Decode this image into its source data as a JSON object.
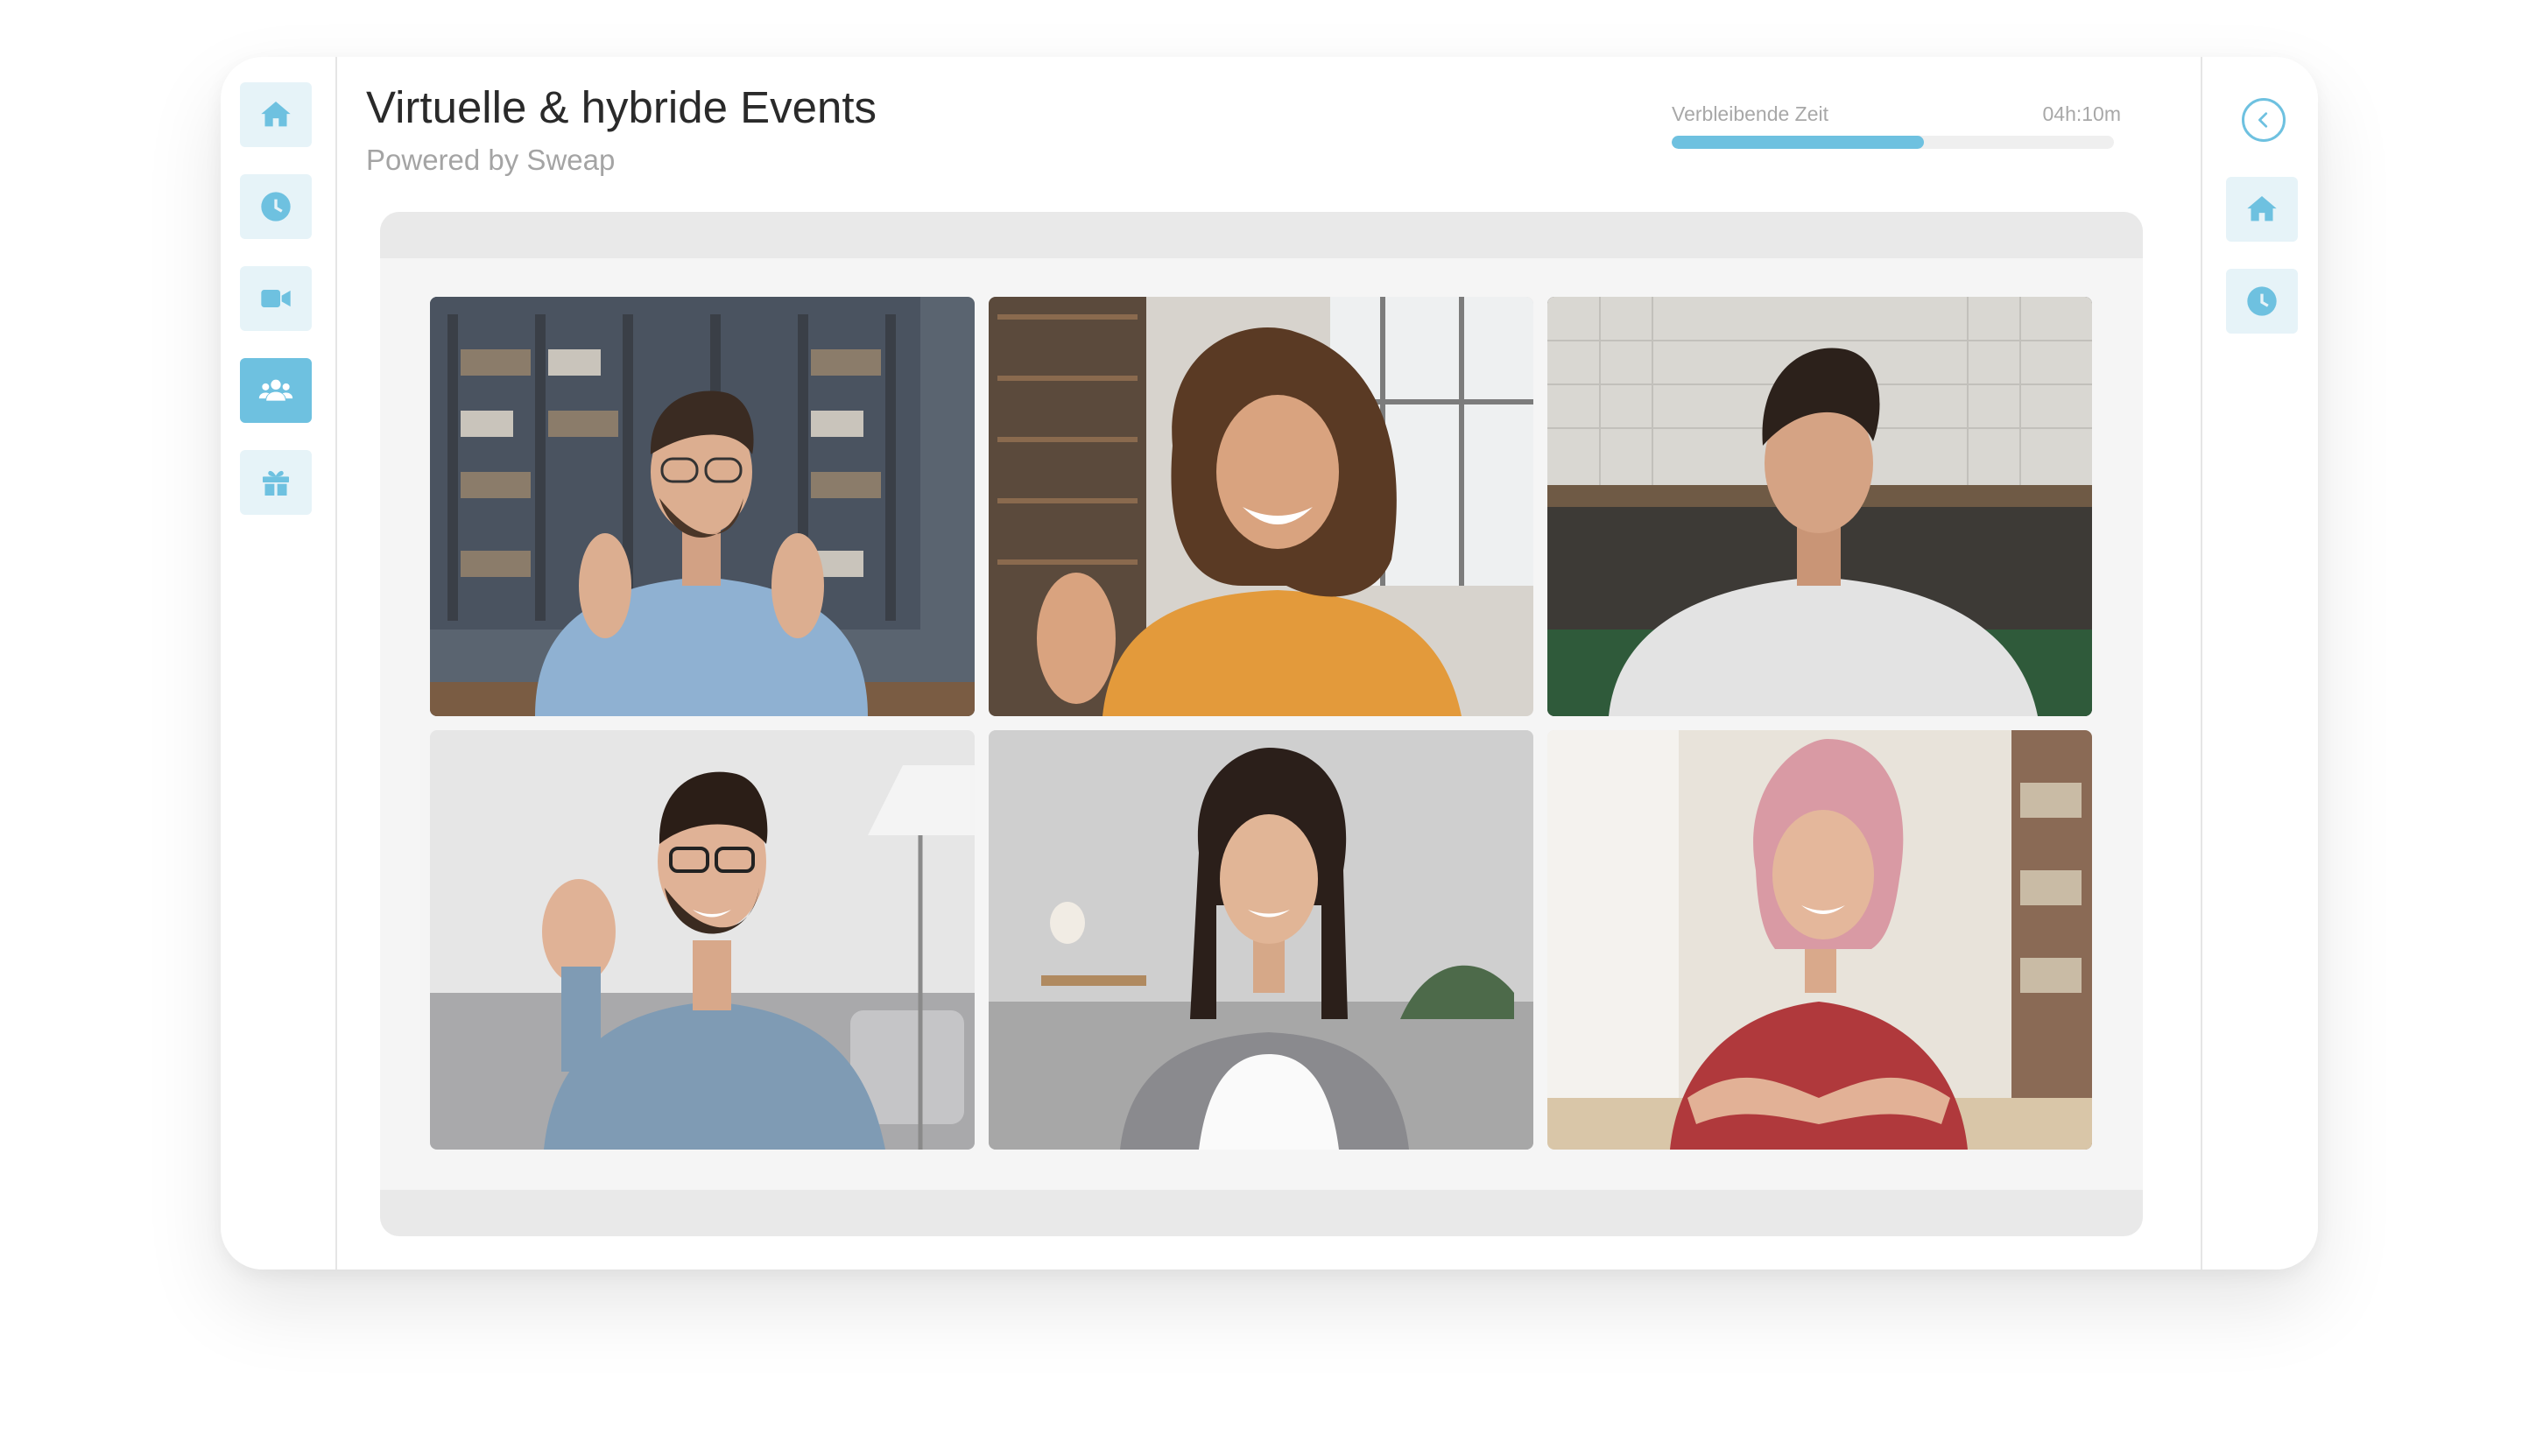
{
  "header": {
    "title": "Virtuelle & hybride Events",
    "subtitle": "Powered by Sweap"
  },
  "timer": {
    "label": "Verbleibende Zeit",
    "value": "04h:10m",
    "progress_percent": 57
  },
  "left_sidebar": {
    "items": [
      {
        "icon": "home-icon",
        "active": false
      },
      {
        "icon": "clock-icon",
        "active": false
      },
      {
        "icon": "video-camera-icon",
        "active": false
      },
      {
        "icon": "users-icon",
        "active": true
      },
      {
        "icon": "gift-icon",
        "active": false
      }
    ]
  },
  "right_sidebar": {
    "items": [
      {
        "icon": "chevron-left-circle-icon"
      },
      {
        "icon": "home-icon"
      },
      {
        "icon": "clock-icon"
      }
    ]
  },
  "participants": [
    {
      "scene": "man with glasses, light blue shirt, bookshelf background"
    },
    {
      "scene": "curly-haired woman in orange hoodie waving, library background"
    },
    {
      "scene": "young man in white t-shirt, kitchen background"
    },
    {
      "scene": "bearded man with glasses waving, grey sofa"
    },
    {
      "scene": "dark-haired woman in grey cardigan, grey sofa"
    },
    {
      "scene": "pink-haired woman in red blouse, arms crossed"
    }
  ],
  "colors": {
    "accent": "#6ec1e0",
    "accent_light": "#e6f3f8",
    "stage_bg": "#f5f5f5",
    "stage_bar": "#e9e9e9"
  }
}
